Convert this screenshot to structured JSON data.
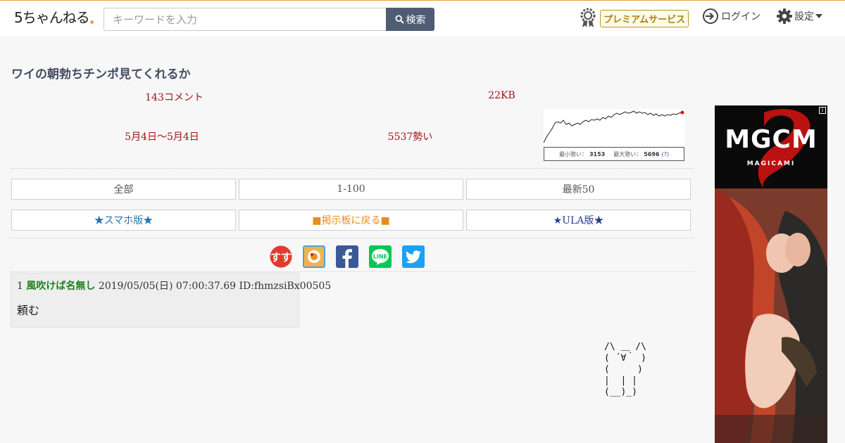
{
  "header": {
    "logo_text": "5ちゃんねる",
    "search_placeholder": "キーワードを入力",
    "search_button": "検索",
    "premium_label": "プレミアムサービス",
    "login_label": "ログイン",
    "settings_label": "設定"
  },
  "thread": {
    "title": "ワイの朝勃ちチンポ見てくれるか",
    "comments": "143コメント",
    "size": "22KB",
    "dates": "5月4日〜5月4日",
    "momentum": "5537勢い",
    "graph": {
      "min_label": "最小勢い：",
      "min_value": "3153",
      "max_label": "最大勢い：",
      "max_value": "5696",
      "help": "(?)"
    }
  },
  "nav": {
    "all": "全部",
    "range": "1-100",
    "latest": "最新50",
    "smartphone": "★スマホ版★",
    "back_to_board": "■掲示板に戻る■",
    "ula": "★ULA版★"
  },
  "share": [
    "matome-icon",
    "app-icon",
    "facebook-icon",
    "line-icon",
    "twitter-icon"
  ],
  "share_line_text": "LINE",
  "share_matome_text": "すす",
  "posts": [
    {
      "number": "1",
      "name": "風吹けば名無し",
      "datetime": "2019/05/05(日) 07:00:37.69",
      "id": "ID:fhmzsiBx00505",
      "body": "頼む"
    }
  ],
  "aa_art": "/\\ ＿ /\\\n( ´∀｀ )\n(     )\n|  | |\n(__)_)",
  "ad": {
    "logo": "MGCM",
    "sub": "MAGICAMI",
    "info": "i"
  },
  "colors": {
    "accent_orange": "#e8a23a",
    "search_button_bg": "#4e5c74",
    "stat_red": "#a11414",
    "poster_name_green": "#1f7d1f",
    "facebook": "#3b5998",
    "line": "#06c755",
    "twitter": "#1da1f2"
  }
}
